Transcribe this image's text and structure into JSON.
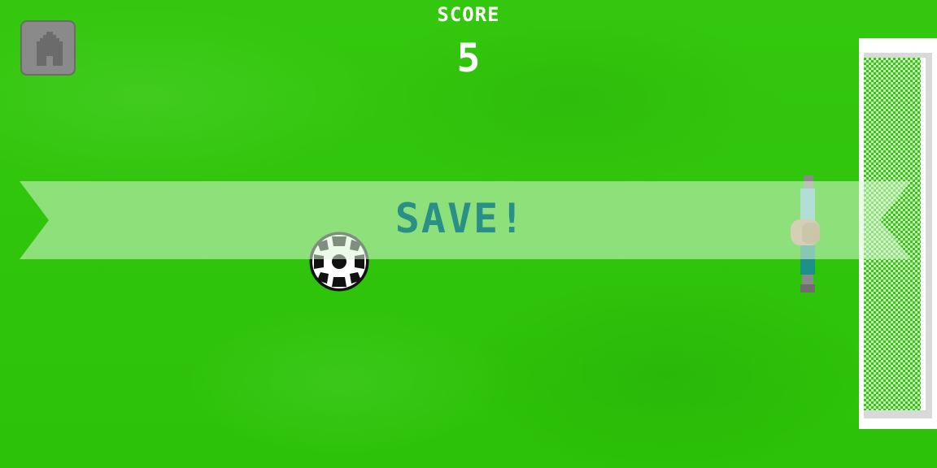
{
  "hud": {
    "score_label": "SCORE",
    "score_value": "5"
  },
  "banner": {
    "text": "SAVE!"
  },
  "icons": {
    "home": "house-icon"
  },
  "colors": {
    "pitch": "#2ec60a",
    "banner_text": "#2a8f86",
    "home_button": "#8a8a8a"
  }
}
